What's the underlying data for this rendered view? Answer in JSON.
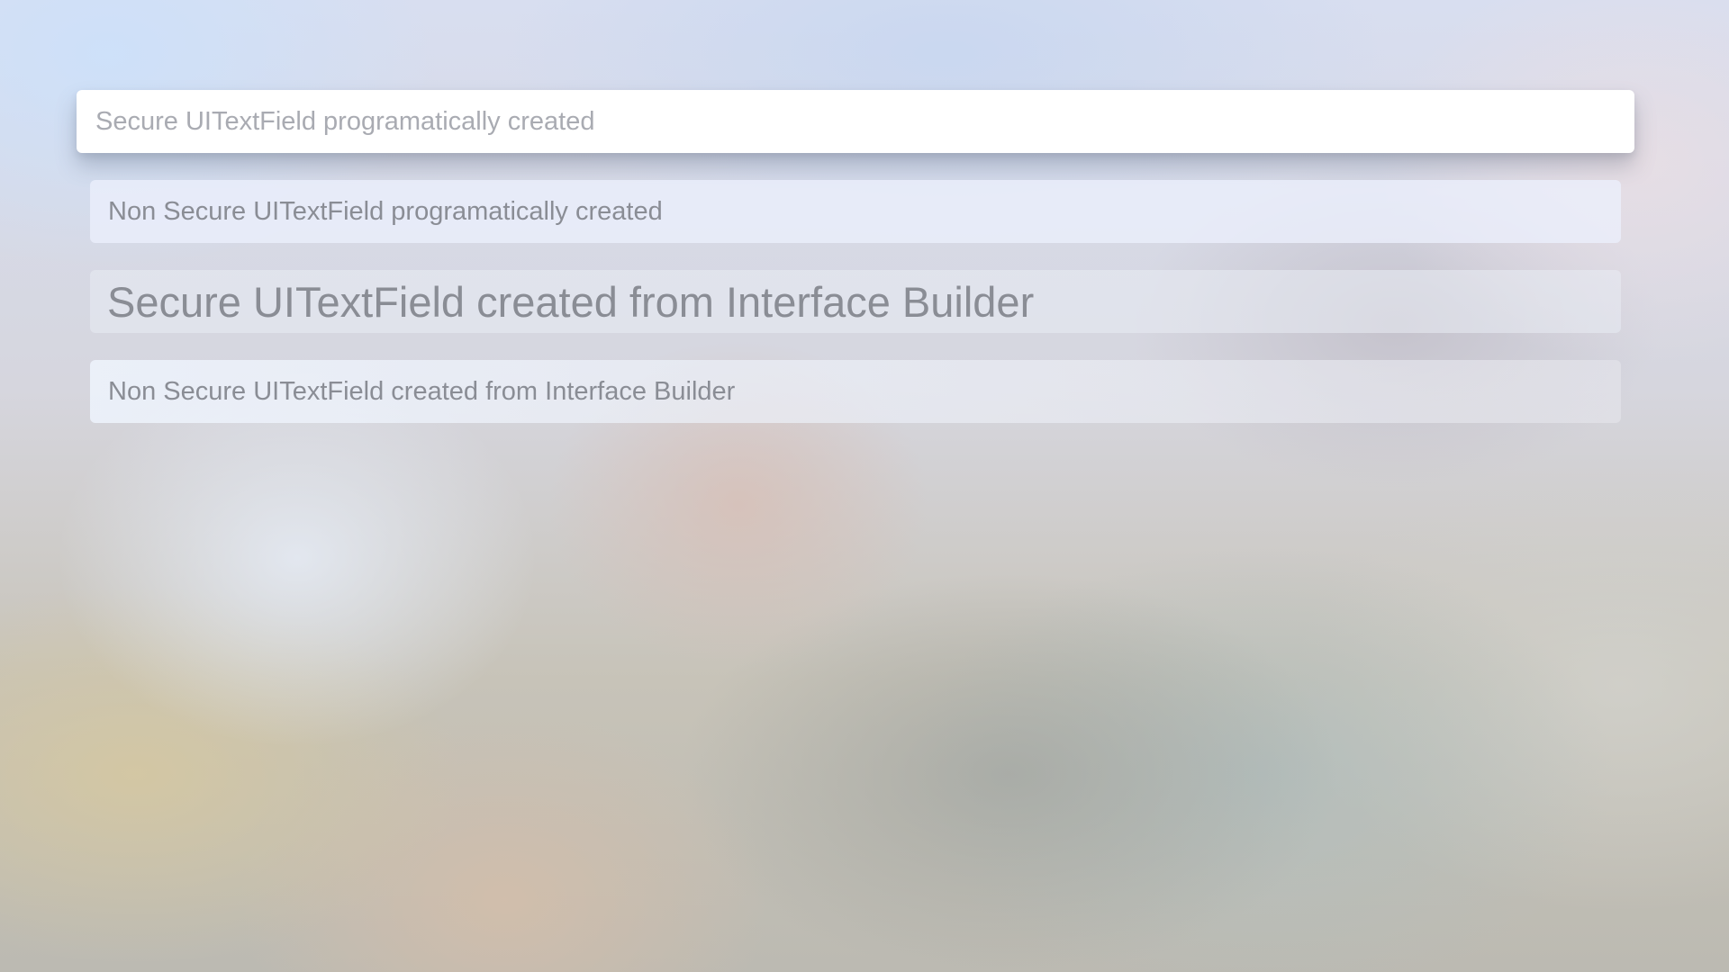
{
  "form": {
    "fields": [
      {
        "placeholder": "Secure UITextField programatically created",
        "secure": true,
        "focused": true
      },
      {
        "placeholder": "Non Secure UITextField programatically created",
        "secure": false,
        "focused": false
      },
      {
        "placeholder": "Secure UITextField created from Interface Builder",
        "secure": true,
        "focused": false
      },
      {
        "placeholder": "Non Secure UITextField created from Interface Builder",
        "secure": false,
        "focused": false
      }
    ]
  },
  "colors": {
    "focused_field_background": "#ffffff",
    "placeholder_text": "#8a8d95",
    "focused_placeholder_text": "#a9abb2"
  }
}
